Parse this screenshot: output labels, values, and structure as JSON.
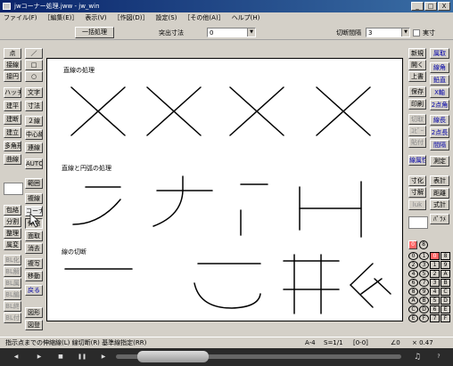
{
  "window": {
    "title": "jwコーナー処理.jww - jw_win",
    "min": "_",
    "max": "□",
    "close": "X"
  },
  "menu": [
    "ファイル(F)",
    "［編集(E)］",
    "表示(V)",
    "［作図(D)］",
    "設定(S)",
    "［その他(A)］",
    "ヘルプ(H)"
  ],
  "toolbar": {
    "batch_label": "一括処理",
    "protrusion_label": "突出寸法",
    "protrusion_value": "0",
    "cut_gap_label": "切断間隔",
    "cut_gap_value": "3",
    "actual_label": "実寸"
  },
  "left_panel": {
    "col1": [
      "点",
      "接線",
      "接円",
      "ハッチ",
      "建平",
      "建断",
      "建立",
      "多角形",
      "曲線",
      "",
      "",
      "包絡",
      "分割",
      "整理",
      "属変",
      "BL化",
      "BL解",
      "BL属",
      "BL編",
      "BL終",
      "BL付"
    ],
    "col2": [
      "／",
      "□",
      "○",
      "文字",
      "寸法",
      "２線",
      "中心線",
      "連線",
      "AUTO",
      "範囲",
      "複線",
      "コーナー",
      "伸縮",
      "面取",
      "消去",
      "複写",
      "移動",
      "戻る",
      "",
      "図形",
      "図登"
    ]
  },
  "right_panel": {
    "col1": [
      "新規",
      "開く",
      "上書",
      "保存",
      "印刷",
      "切取",
      "ｺﾋﾟｰ",
      "貼付",
      "線属性",
      "寸化",
      "寸解",
      "luk",
      "",
      "",
      "0"
    ],
    "col2": [
      "属取",
      "線角",
      "鉛直",
      "X軸",
      "2点角",
      "線長",
      "2点長",
      "間隔",
      "測定",
      "表計",
      "距離",
      "",
      "式計",
      "ﾊﾟﾗﾒ",
      "8"
    ],
    "layer_groups": [
      "0",
      "1",
      "2",
      "3",
      "4",
      "5",
      "6",
      "7",
      "8",
      "9",
      "A",
      "B",
      "C",
      "D",
      "E",
      "F"
    ],
    "layers": [
      "0",
      "1",
      "2",
      "3",
      "4",
      "5",
      "6",
      "7",
      "8",
      "9",
      "A",
      "B",
      "C",
      "D",
      "E",
      "F"
    ]
  },
  "drawing": {
    "label1": "直線の処理",
    "label2": "直線と円弧の処理",
    "label3": "線の切断"
  },
  "status": {
    "message": "指示点までの伸縮線(L) 線切断(R) 基準線指定(RR)",
    "paper": "A-4",
    "scale": "S=1/1",
    "layer": "[0-0]",
    "angle": "∠0",
    "zoom": "× 0.47"
  },
  "player": {
    "music_icon": "♫",
    "help": "?"
  }
}
